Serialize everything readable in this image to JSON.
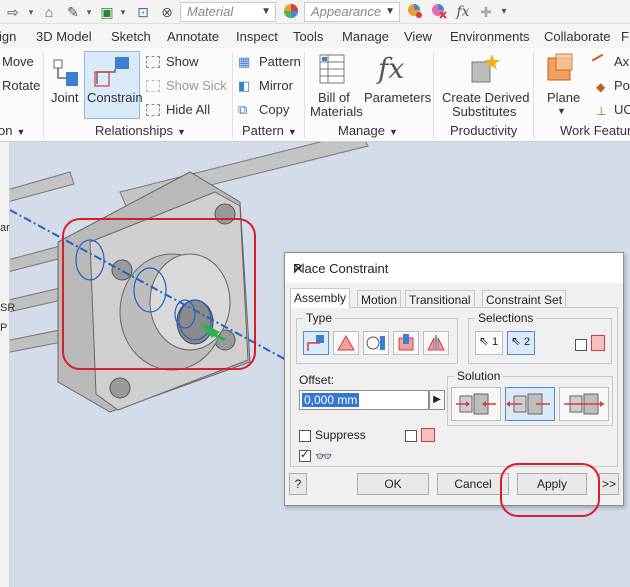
{
  "qat": {
    "material_placeholder": "Material",
    "appearance_placeholder": "Appearance",
    "fx_label": "fx"
  },
  "ribbon_tabs": [
    "ign",
    "3D Model",
    "Sketch",
    "Annotate",
    "Inspect",
    "Tools",
    "Manage",
    "View",
    "Environments",
    "Collaborate",
    "F"
  ],
  "ribbon": {
    "move": "Move",
    "rotate": "Rotate",
    "joint": "Joint",
    "constrain": "Constrain",
    "show": "Show",
    "show_sick": "Show Sick",
    "hide_all": "Hide All",
    "pattern": "Pattern",
    "mirror": "Mirror",
    "copy": "Copy",
    "bill_of_materials_1": "Bill of",
    "bill_of_materials_2": "Materials",
    "parameters": "Parameters",
    "create_derived_1": "Create Derived",
    "create_derived_2": "Substitutes",
    "plane": "Plane",
    "axis": "Axi",
    "point": "Poi",
    "ucs": "UC",
    "groups": {
      "position": "on",
      "relationships": "Relationships",
      "pattern": "Pattern",
      "manage": "Manage",
      "productivity": "Productivity",
      "work_features": "Work Feature"
    }
  },
  "browser": {
    "frag1": "ar",
    "frag2": "SR",
    "frag3": "P"
  },
  "dialog": {
    "title": "Place Constraint",
    "tabs": [
      "Assembly",
      "Motion",
      "Transitional",
      "Constraint Set"
    ],
    "type_label": "Type",
    "selections_label": "Selections",
    "sel1": "1",
    "sel2": "2",
    "offset_label": "Offset:",
    "offset_value": "0,000 mm",
    "solution_label": "Solution",
    "suppress_label": "Suppress",
    "ok": "OK",
    "cancel": "Cancel",
    "apply": "Apply",
    "more": ">>"
  },
  "colors": {
    "accent_blue": "#1f63c8",
    "highlight_red": "#d91e26",
    "part_gray": "#c8c8c8"
  }
}
